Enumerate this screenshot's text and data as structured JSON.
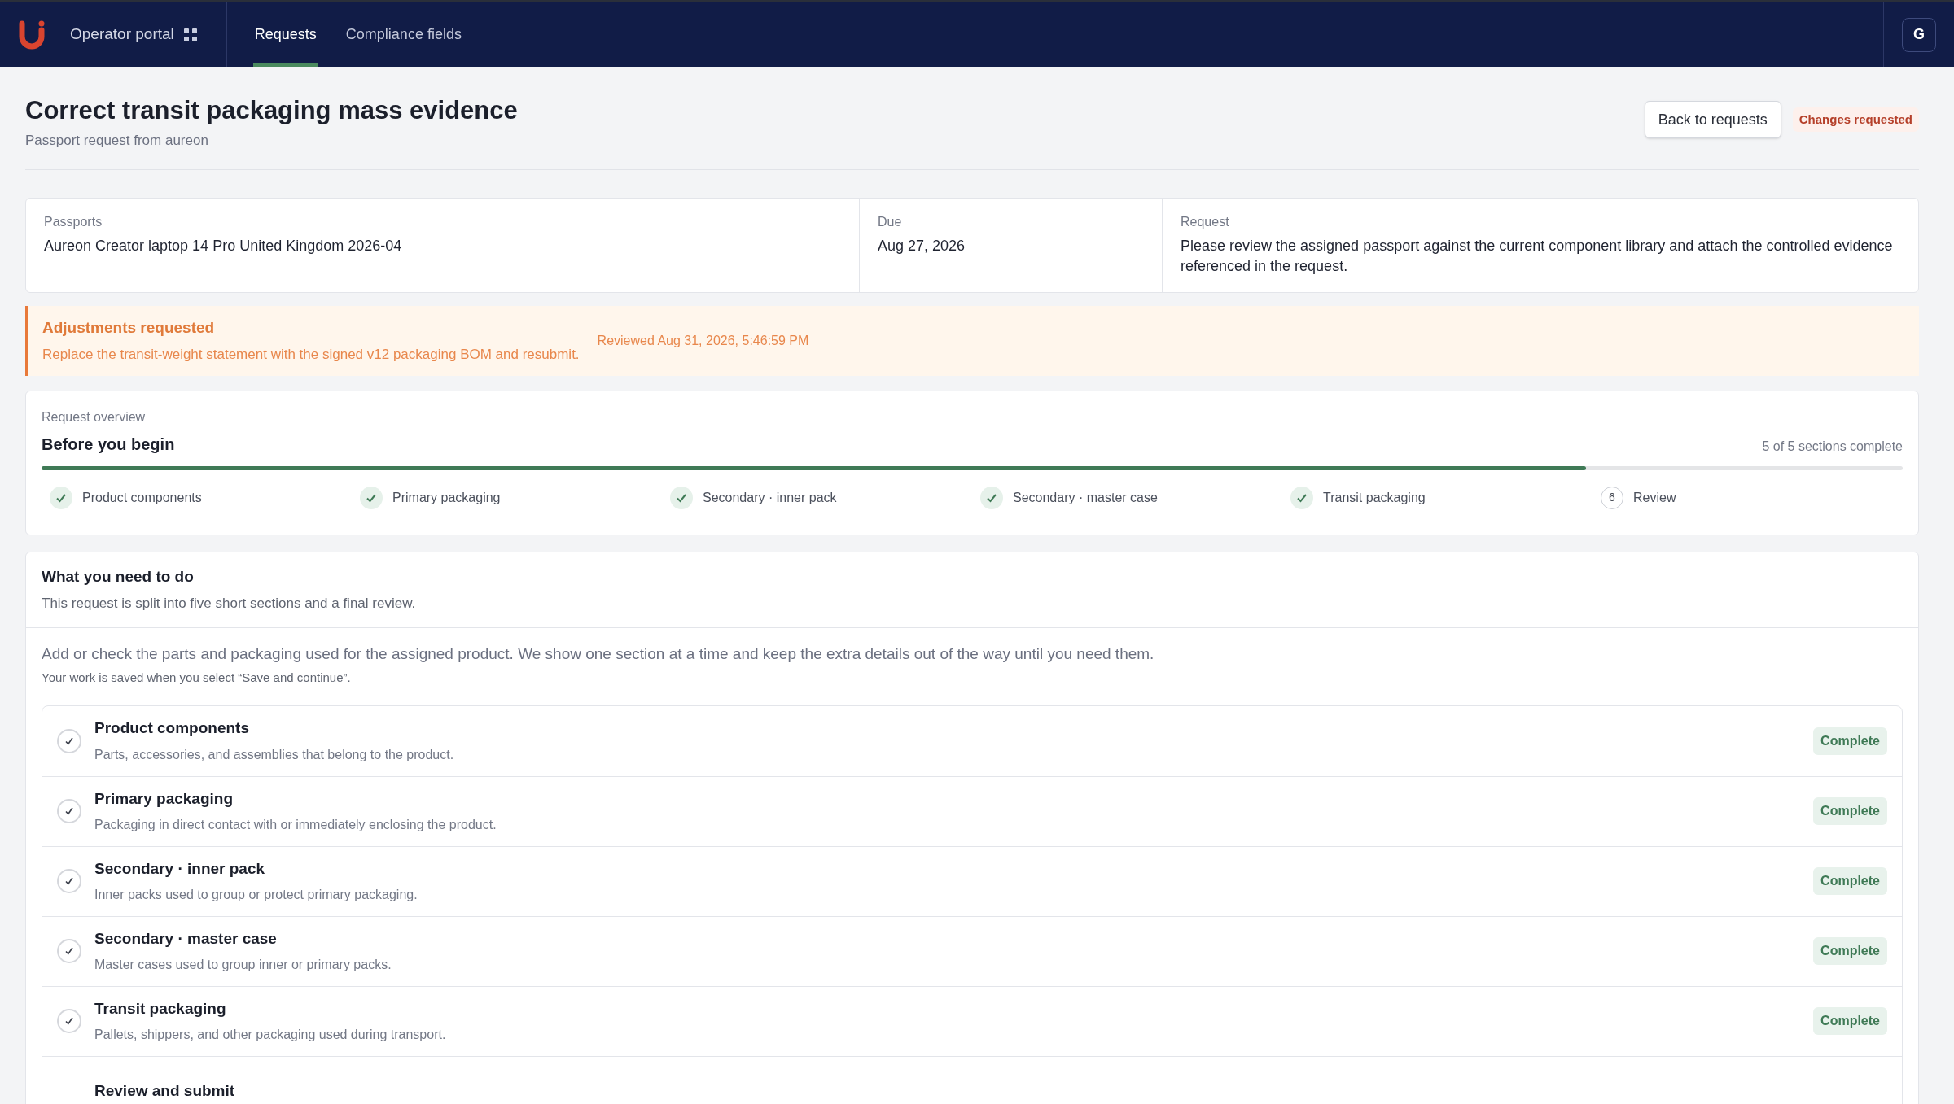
{
  "nav": {
    "portal_label": "Operator portal",
    "tabs": [
      {
        "label": "Requests",
        "selected": true
      },
      {
        "label": "Compliance fields",
        "selected": false
      }
    ],
    "avatar": "G"
  },
  "header": {
    "title": "Correct transit packaging mass evidence",
    "subtitle": "Passport request from aureon",
    "back_button": "Back to requests",
    "status_badge": "Changes requested"
  },
  "info": [
    {
      "label": "Passports",
      "value": "Aureon Creator laptop 14 Pro United Kingdom 2026-04"
    },
    {
      "label": "Due",
      "value": "Aug 27, 2026"
    },
    {
      "label": "Request",
      "value": "Please review the assigned passport against the current component library and attach the controlled evidence referenced in the request."
    }
  ],
  "alert": {
    "title": "Adjustments requested",
    "message": "Replace the transit-weight statement with the signed v12 packaging BOM and resubmit.",
    "reviewed": "Reviewed Aug 31, 2026, 5:46:59 PM"
  },
  "overview": {
    "eyebrow": "Request overview",
    "title": "Before you begin",
    "summary": "5 of 5 sections complete",
    "progress": {
      "level": 0.83
    },
    "steps": [
      {
        "label": "Product components",
        "done": true
      },
      {
        "label": "Primary packaging",
        "done": true
      },
      {
        "label": "Secondary · inner pack",
        "done": true
      },
      {
        "label": "Secondary · master case",
        "done": true
      },
      {
        "label": "Transit packaging",
        "done": true
      },
      {
        "label": "Review",
        "done": false,
        "number": "6"
      }
    ]
  },
  "tasks": {
    "title": "What you need to do",
    "subtitle": "This request is split into five short sections and a final review.",
    "intro": "Add or check the parts and packaging used for the assigned product. We show one section at a time and keep the extra details out of the way until you need them.",
    "note": "Your work is saved when you select “Save and continue”.",
    "items": [
      {
        "title": "Product components",
        "description": "Parts, accessories, and assemblies that belong to the product.",
        "complete": true,
        "status": "Complete"
      },
      {
        "title": "Primary packaging",
        "description": "Packaging in direct contact with or immediately enclosing the product.",
        "complete": true,
        "status": "Complete"
      },
      {
        "title": "Secondary · inner pack",
        "description": "Inner packs used to group or protect primary packaging.",
        "complete": true,
        "status": "Complete"
      },
      {
        "title": "Secondary · master case",
        "description": "Master cases used to group inner or primary packs.",
        "complete": true,
        "status": "Complete"
      },
      {
        "title": "Transit packaging",
        "description": "Pallets, shippers, and other packaging used during transport.",
        "complete": true,
        "status": "Complete"
      },
      {
        "title": "Review and submit"
      }
    ]
  }
}
